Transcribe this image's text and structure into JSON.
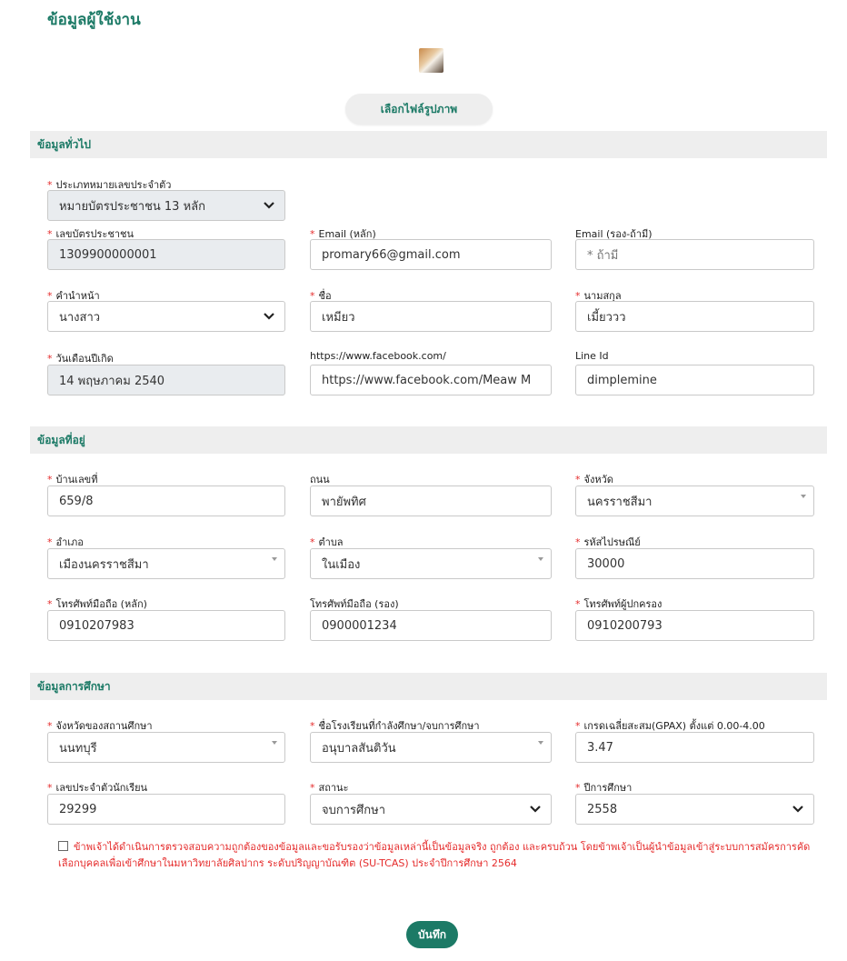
{
  "page_title": "ข้อมูลผู้ใช้งาน",
  "choose_image_label": "เลือกไฟล์รูปภาพ",
  "sections": {
    "general": "ข้อมูลทั่วไป",
    "address": "ข้อมูลที่อยู่",
    "education": "ข้อมูลการศึกษา"
  },
  "general": {
    "id_type": {
      "label": "ประเภทหมายเลขประจำตัว",
      "value": "หมายบัตรประชาชน 13 หลัก"
    },
    "id_number": {
      "label": "เลขบัตรประชาชน",
      "value": "1309900000001"
    },
    "email_main": {
      "label": "Email (หลัก)",
      "value": "promary66@gmail.com"
    },
    "email_alt": {
      "label": "Email (รอง-ถ้ามี)",
      "placeholder": "* ถ้ามี"
    },
    "prefix": {
      "label": "คำนำหน้า",
      "value": "นางสาว"
    },
    "first_name": {
      "label": "ชื่อ",
      "value": "เหมียว"
    },
    "last_name": {
      "label": "นามสกุล",
      "value": "เมี้ยววว"
    },
    "birthdate": {
      "label": "วันเดือนปีเกิด",
      "value": "14 พฤษภาคม 2540"
    },
    "facebook": {
      "label": "https://www.facebook.com/",
      "value": "https://www.facebook.com/Meaw M"
    },
    "line_id": {
      "label": "Line Id",
      "value": "dimplemine"
    }
  },
  "address": {
    "house_no": {
      "label": "บ้านเลขที่",
      "value": "659/8"
    },
    "road": {
      "label": "ถนน",
      "value": "พายัพทิศ"
    },
    "province": {
      "label": "จังหวัด",
      "value": "นครราชสีมา"
    },
    "district": {
      "label": "อำเภอ",
      "value": "เมืองนครราชสีมา"
    },
    "subdistrict": {
      "label": "ตำบล",
      "value": "ในเมือง"
    },
    "postcode": {
      "label": "รหัสไปรษณีย์",
      "value": "30000"
    },
    "mobile_main": {
      "label": "โทรศัพท์มือถือ (หลัก)",
      "value": "0910207983"
    },
    "mobile_alt": {
      "label": "โทรศัพท์มือถือ (รอง)",
      "value": "0900001234"
    },
    "guardian_phone": {
      "label": "โทรศัพท์ผู้ปกครอง",
      "value": "0910200793"
    }
  },
  "education": {
    "school_province": {
      "label": "จังหวัดของสถานศึกษา",
      "value": "นนทบุรี"
    },
    "school_name": {
      "label": "ชื่อโรงเรียนที่กำลังศึกษา/จบการศึกษา",
      "value": "อนุบาลสันติวัน"
    },
    "gpax": {
      "label": "เกรดเฉลี่ยสะสม(GPAX) ตั้งแต่ 0.00-4.00",
      "value": "3.47"
    },
    "student_id": {
      "label": "เลขประจำตัวนักเรียน",
      "value": "29299"
    },
    "status": {
      "label": "สถานะ",
      "value": "จบการศึกษา"
    },
    "year": {
      "label": "ปีการศึกษา",
      "value": "2558"
    }
  },
  "consent_text": "ข้าพเจ้าได้ดำเนินการตรวจสอบความถูกต้องของข้อมูลและขอรับรองว่าข้อมูลเหล่านี้เป็นข้อมูลจริง ถูกต้อง และครบถ้วน โดยข้าพเจ้าเป็นผู้นำข้อมูลเข้าสู่ระบบการสมัครการคัดเลือกบุคคลเพื่อเข้าศึกษาในมหาวิทยาลัยศิลปากร ระดับปริญญาบัณฑิต (SU-TCAS) ประจำปีการศึกษา 2564",
  "save_label": "บันทึก",
  "required_mark": "*",
  "colors": {
    "brand": "#1c7a66",
    "required": "#e52b2b",
    "section_bg": "#eeeeee"
  }
}
